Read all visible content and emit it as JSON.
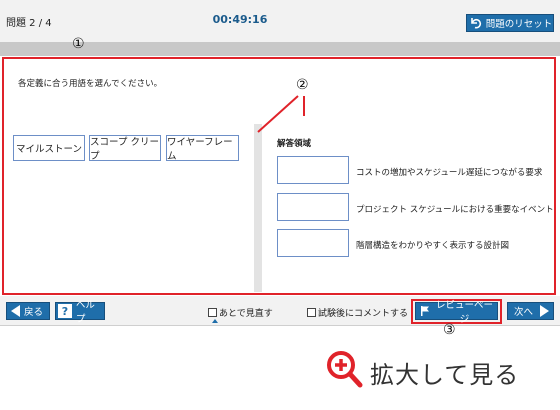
{
  "header": {
    "question_count": "問題 2 / 4",
    "timer": "00:49:16",
    "reset_label": "問題のリセット"
  },
  "callouts": [
    "①",
    "②",
    "③"
  ],
  "question": {
    "instruction": "各定義に合う用語を選んでください。",
    "choices": [
      "マイルストーン",
      "スコープ クリープ",
      "ワイヤーフレーム"
    ],
    "answer_area_title": "解答領域",
    "definitions": [
      "コストの増加やスケジュール遅延につながる要求",
      "プロジェクト スケジュールにおける重要なイベント",
      "階層構造をわかりやすく表示する設計図"
    ]
  },
  "footer": {
    "back_label": "戻る",
    "help_label": "ヘルプ",
    "review_later_label": "あとで見直す",
    "comment_label": "試験後にコメントする",
    "review_page_label": "レビューページ",
    "next_label": "次へ"
  },
  "zoom": {
    "label": "拡大して見る"
  },
  "colors": {
    "accent_blue": "#1f6eaa",
    "timer_blue": "#1b5b8c",
    "highlight_red": "#e0232a",
    "choice_border": "#6d8fc7"
  },
  "icons": [
    "reset-icon",
    "back-arrow-icon",
    "help-icon",
    "review-flag-icon",
    "next-arrow-icon",
    "zoom-in-icon"
  ]
}
